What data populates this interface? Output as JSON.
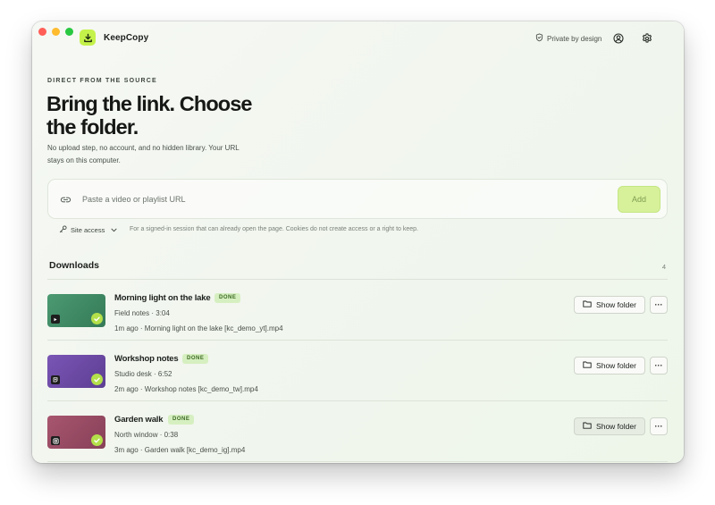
{
  "app": {
    "name": "KeepCopy",
    "logo_icon": "download-icon",
    "accent": "#c5f24a"
  },
  "header": {
    "privacy_label": "Private by design",
    "profile_icon": "profile-icon",
    "settings_icon": "gear-icon"
  },
  "hero": {
    "eyebrow": "DIRECT FROM THE SOURCE",
    "headline": "Bring the link. Choose the folder.",
    "subcopy": "No upload step, no account, and no hidden library. Your URL stays on this computer."
  },
  "url_bar": {
    "placeholder": "Paste a video or playlist URL",
    "value": "",
    "add_label": "Add"
  },
  "site_access": {
    "label": "Site access",
    "note": "For a signed-in session that can already open the page. Cookies do not create access or a right to keep."
  },
  "downloads": {
    "title": "Downloads",
    "count": "4",
    "items": [
      {
        "title": "Morning light on the lake",
        "status": "DONE",
        "meta": "Field notes · 3:04",
        "file": "1m ago · Morning light on the lake [kc_demo_yt].mp4",
        "thumb_color": "#3f8a66",
        "source_icon": "youtube-icon",
        "folder_label": "Show folder",
        "more_label": "···"
      },
      {
        "title": "Workshop notes",
        "status": "DONE",
        "meta": "Studio desk · 6:52",
        "file": "2m ago · Workshop notes [kc_demo_tw].mp4",
        "thumb_color": "#6a4aa3",
        "source_icon": "twitch-icon",
        "folder_label": "Show folder",
        "more_label": "···"
      },
      {
        "title": "Garden walk",
        "status": "DONE",
        "meta": "North window · 0:38",
        "file": "3m ago · Garden walk [kc_demo_ig].mp4",
        "thumb_color": "#9c4b67",
        "source_icon": "instagram-icon",
        "folder_label": "Show folder",
        "more_label": "···"
      }
    ]
  }
}
